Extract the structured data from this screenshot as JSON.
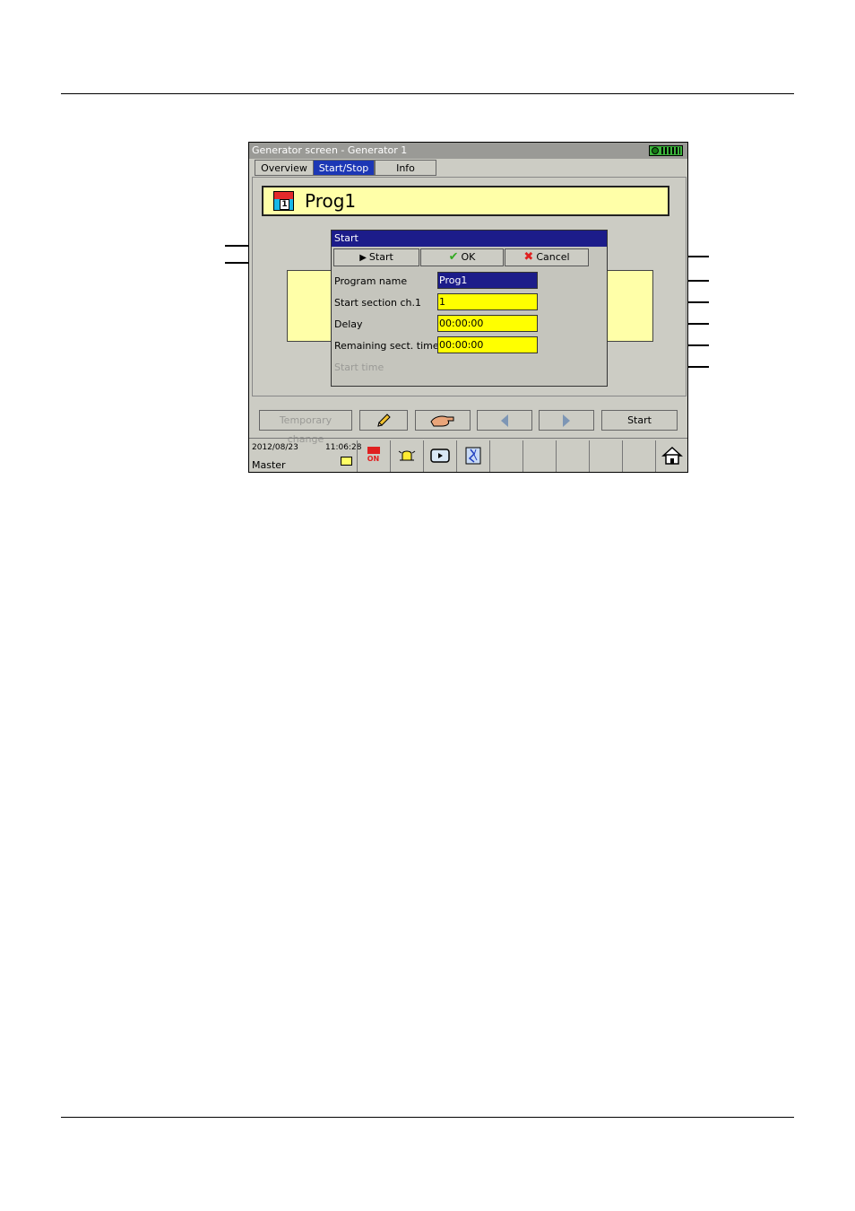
{
  "screen": {
    "title": "Generator screen - Generator 1",
    "tabs": [
      {
        "label": "Overview",
        "active": false
      },
      {
        "label": "Start/Stop",
        "active": true
      },
      {
        "label": "Info",
        "active": false
      }
    ],
    "program_banner": {
      "icon_number": "1",
      "name": "Prog1"
    },
    "dialog": {
      "title": "Start",
      "buttons": {
        "start": "Start",
        "ok": "OK",
        "cancel": "Cancel"
      },
      "fields": [
        {
          "label": "Program name",
          "value": "Prog1"
        },
        {
          "label": "Start section ch.1",
          "value": "1"
        },
        {
          "label": "Delay",
          "value": "00:00:00"
        },
        {
          "label": "Remaining sect. time",
          "value": "00:00:00"
        }
      ],
      "start_time_label": "Start time"
    },
    "bottom_buttons": {
      "temporary_change": "Temporary change",
      "start": "Start"
    },
    "status": {
      "date": "2012/08/23",
      "time": "11:06:28",
      "user": "Master",
      "record_label": "ON"
    }
  },
  "colors": {
    "title_bar": "#9a9a96",
    "active_tab": "#1c37b5",
    "dialog_title": "#1c1c8a",
    "field_yellow": "#ffff00",
    "banner_yellow": "#ffffa8",
    "ok_check": "#33aa22",
    "cancel_x": "#e02020"
  }
}
